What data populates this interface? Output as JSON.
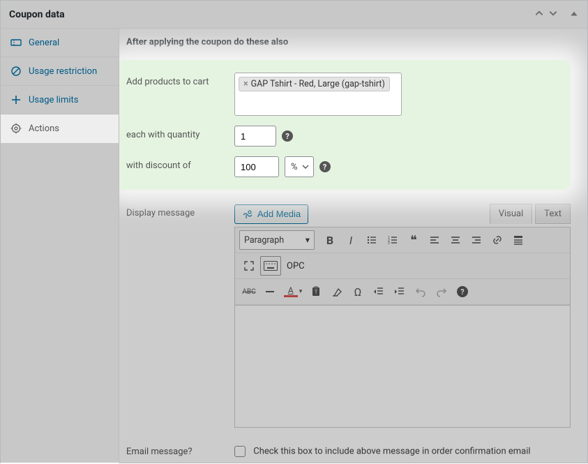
{
  "header": {
    "title": "Coupon data"
  },
  "tabs": {
    "general": "General",
    "usage_restriction": "Usage restriction",
    "usage_limits": "Usage limits",
    "actions": "Actions"
  },
  "section_title": "After applying the coupon do these also",
  "labels": {
    "add_products": "Add products to cart",
    "each_qty": "each with quantity",
    "discount": "with discount of",
    "display_message": "Display message",
    "email_message": "Email message?"
  },
  "values": {
    "product_tag": "GAP Tshirt - Red, Large (gap-tshirt)",
    "quantity": "1",
    "discount_amount": "100",
    "discount_unit": "%"
  },
  "editor": {
    "add_media": "Add Media",
    "tab_visual": "Visual",
    "tab_text": "Text",
    "paragraph": "Paragraph",
    "opc": "OPC",
    "abc": "ABC"
  },
  "email_checkbox_label": "Check this box to include above message in order confirmation email"
}
